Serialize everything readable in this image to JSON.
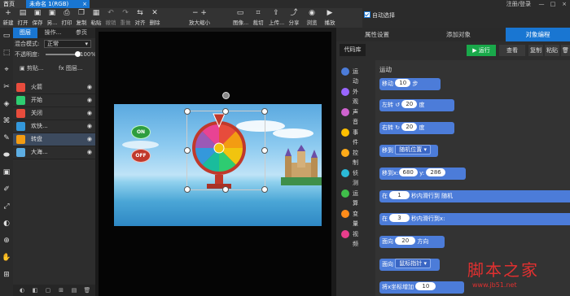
{
  "tabbar": {
    "home": "首页",
    "document": "未命名 1(RGB)",
    "close": "×",
    "login": "注册/登录",
    "window_buttons": [
      "—",
      "□",
      "×"
    ]
  },
  "toolbar": {
    "tools": [
      {
        "label": "新建",
        "icon": "new-file-icon",
        "glyph": "+"
      },
      {
        "label": "打开",
        "icon": "open-icon",
        "glyph": "▤"
      },
      {
        "label": "保存",
        "icon": "save-icon",
        "glyph": "▣"
      },
      {
        "label": "另...",
        "icon": "save-as-icon",
        "glyph": "▣"
      },
      {
        "label": "打印",
        "icon": "print-icon",
        "glyph": "⎙"
      },
      {
        "label": "复制",
        "icon": "copy-icon",
        "glyph": "❐"
      },
      {
        "label": "粘贴",
        "icon": "paste-icon",
        "glyph": "▦"
      },
      {
        "label": "撤销",
        "icon": "undo-icon",
        "glyph": "↶",
        "dim": true
      },
      {
        "label": "重做",
        "icon": "redo-icon",
        "glyph": "↷",
        "dim": true
      },
      {
        "label": "对齐",
        "icon": "align-icon",
        "glyph": "⇆"
      },
      {
        "label": "删除",
        "icon": "delete-icon",
        "glyph": "✕"
      },
      {
        "label": "放大缩小",
        "icon": "zoom-icon",
        "glyph": "−  +"
      },
      {
        "label": "图像...",
        "icon": "image-icon",
        "glyph": "▭"
      },
      {
        "label": "裁切",
        "icon": "crop-icon",
        "glyph": "⌗"
      },
      {
        "label": "上传...",
        "icon": "upload-icon",
        "glyph": "⇪"
      },
      {
        "label": "分享",
        "icon": "share-icon",
        "glyph": "⤴"
      },
      {
        "label": "浏览",
        "icon": "browse-icon",
        "glyph": "◉"
      },
      {
        "label": "播放",
        "icon": "play-icon",
        "glyph": "▶"
      }
    ],
    "auto_select": "自动选择"
  },
  "lefttools": [
    "▭",
    "⬚",
    "⌖",
    "✂",
    "◈",
    "⌘",
    "✎",
    "⬬",
    "▣",
    "✐",
    "⤢",
    "◐",
    "⊕",
    "✋",
    "⊞"
  ],
  "layers_panel": {
    "tabs": [
      "图层",
      "操作...",
      "参页"
    ],
    "blend_label": "混合模式:",
    "blend_value": "正常",
    "opacity_label": "不透明度:",
    "opacity_value": "100%",
    "opacity_fraction": 1.0,
    "clip_button": "剪贴...",
    "layer_button": "图层...",
    "layers": [
      {
        "name": "火箭",
        "color": "#e84c3d",
        "selected": false
      },
      {
        "name": "开始",
        "color": "#2ecc71",
        "selected": false
      },
      {
        "name": "关闭",
        "color": "#e74c3c",
        "selected": false
      },
      {
        "name": "欢快...",
        "color": "#3498db",
        "selected": false
      },
      {
        "name": "转盘",
        "color": "#f39c12",
        "selected": true
      },
      {
        "name": "大海...",
        "color": "#5dade2",
        "selected": false
      }
    ],
    "footer_icons": [
      "◐",
      "◧",
      "▢",
      "⊞",
      "▤",
      "🗑"
    ]
  },
  "stage": {
    "on_label": "ON",
    "off_label": "OFF"
  },
  "right_panel": {
    "tabs": [
      "属性设置",
      "添加对象",
      "对象编程"
    ],
    "code_library": "代码库",
    "run": "▶ 运行",
    "view": "查看",
    "copy": "复制",
    "paste": "粘贴",
    "categories": [
      {
        "name": "运动",
        "color": "#4c7cd9"
      },
      {
        "name": "外观",
        "color": "#9966ff"
      },
      {
        "name": "声音",
        "color": "#cf63cf"
      },
      {
        "name": "事件",
        "color": "#ffbf00"
      },
      {
        "name": "控制",
        "color": "#ffab19"
      },
      {
        "name": "侦测",
        "color": "#2bbbd8"
      },
      {
        "name": "运算",
        "color": "#40bf4a"
      },
      {
        "name": "变量",
        "color": "#ff8c1a"
      },
      {
        "name": "视频",
        "color": "#e83e8c"
      }
    ],
    "motion_header": "运动",
    "blocks": {
      "move": {
        "a": "移动",
        "v": "10",
        "b": "步"
      },
      "turn_left": {
        "a": "左转",
        "v": "20",
        "b": "度"
      },
      "turn_right": {
        "a": "右转",
        "v": "20",
        "b": "度"
      },
      "goto": {
        "a": "移到",
        "dd": "随机位置 ▾"
      },
      "goto_xy": {
        "a": "移到x:",
        "x": "680",
        "y_label": "y:",
        "y": "286"
      },
      "glide1": {
        "a": "在",
        "v": "1",
        "b": "秒内滑行到",
        "c": "随机"
      },
      "glide2": {
        "a": "在",
        "v": "3",
        "b": "秒内滑行到x:"
      },
      "point_dir": {
        "a": "面向",
        "v": "20",
        "b": "方向"
      },
      "point_towards": {
        "a": "面向",
        "dd": "鼠标指针 ▾"
      },
      "change_x": {
        "a": "将x坐标增加",
        "v": "10"
      }
    }
  },
  "watermark": {
    "title": "脚本之家",
    "url": "www.jb51.net"
  }
}
